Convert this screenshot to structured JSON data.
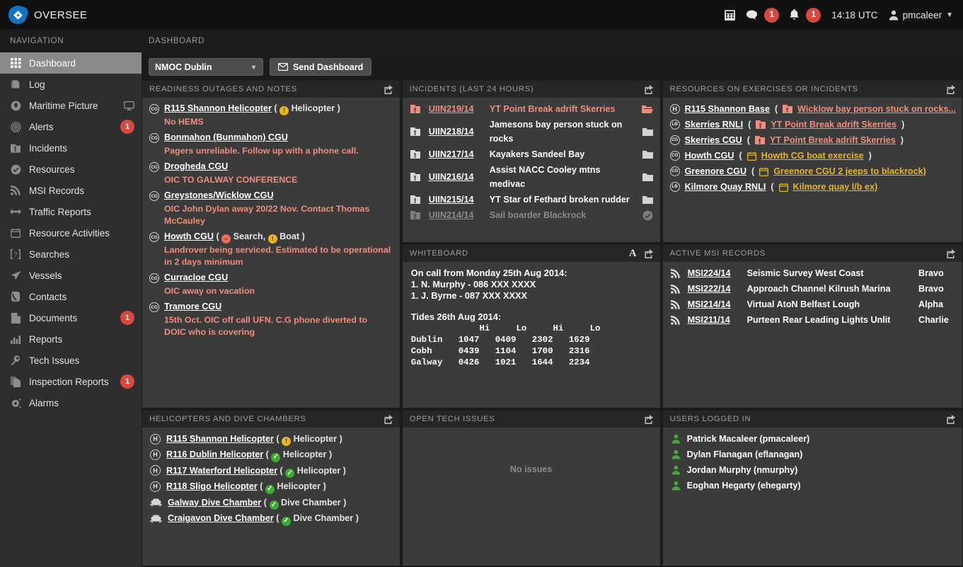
{
  "app": {
    "name": "OVERSEE"
  },
  "topbar": {
    "calculator_icon": "calculator-icon",
    "messages_icon": "chat-icon",
    "messages_count": "1",
    "alerts_icon": "bell-icon",
    "alerts_count": "1",
    "clock": "14:18 UTC",
    "user": "pmcaleer"
  },
  "sidebar": {
    "title": "NAVIGATION",
    "items": [
      {
        "label": "Dashboard",
        "icon": "grid-icon",
        "active": true
      },
      {
        "label": "Log",
        "icon": "book-icon"
      },
      {
        "label": "Maritime Picture",
        "icon": "globe-icon",
        "trailing_icon": "monitor-icon"
      },
      {
        "label": "Alerts",
        "icon": "target-icon",
        "badge": "1"
      },
      {
        "label": "Incidents",
        "icon": "incident-icon"
      },
      {
        "label": "Resources",
        "icon": "check-circle-icon"
      },
      {
        "label": "MSI Records",
        "icon": "rss-icon"
      },
      {
        "label": "Traffic Reports",
        "icon": "arrows-icon"
      },
      {
        "label": "Resource Activities",
        "icon": "calendar-icon"
      },
      {
        "label": "Searches",
        "icon": "search-brackets-icon"
      },
      {
        "label": "Vessels",
        "icon": "vessel-icon"
      },
      {
        "label": "Contacts",
        "icon": "phone-icon"
      },
      {
        "label": "Documents",
        "icon": "document-icon",
        "badge": "1"
      },
      {
        "label": "Reports",
        "icon": "chart-icon"
      },
      {
        "label": "Tech Issues",
        "icon": "wrench-icon"
      },
      {
        "label": "Inspection Reports",
        "icon": "copy-icon",
        "badge": "1"
      },
      {
        "label": "Alarms",
        "icon": "alarm-icon"
      }
    ]
  },
  "main": {
    "header": "DASHBOARD",
    "toolbar": {
      "location_select": "NMOC Dublin",
      "send_dashboard": "Send Dashboard",
      "send_icon": "envelope-icon"
    }
  },
  "panels": {
    "readiness": {
      "title": "READINESS OUTAGES AND NOTES",
      "export_icon": "export-icon",
      "items": [
        {
          "name": "R115 Shannon Helicopter",
          "badge_icon": "cg-icon",
          "status": [
            {
              "type": "warn",
              "label": "Helicopter"
            }
          ],
          "note": "No HEMS"
        },
        {
          "name": "Bonmahon (Bunmahon) CGU",
          "badge_icon": "cg-icon",
          "status": [],
          "note": "Pagers unreliable. Follow up with a phone call."
        },
        {
          "name": "Drogheda CGU",
          "badge_icon": "cg-icon",
          "status": [],
          "note": "OIC TO GALWAY CONFERENCE"
        },
        {
          "name": "Greystones/Wicklow CGU",
          "badge_icon": "cg-icon",
          "status": [],
          "note": "OIC John Dylan away 20/22 Nov. Contact Thomas McCauley"
        },
        {
          "name": "Howth CGU",
          "badge_icon": "cg-icon",
          "status": [
            {
              "type": "stop",
              "label": "Search"
            },
            {
              "type": "warn",
              "label": "Boat"
            }
          ],
          "note": "Landrover being serviced. Estimated to be operational in 2 days minimum"
        },
        {
          "name": "Curracloe CGU",
          "badge_icon": "cg-icon",
          "status": [],
          "note": "OIC away on vacation"
        },
        {
          "name": "Tramore CGU",
          "badge_icon": "cg-icon",
          "status": [],
          "note": "15th Oct. OIC off call UFN. C.G phone diverted to DOIC who is covering"
        }
      ]
    },
    "incidents": {
      "title": "INCIDENTS (LAST 24 HOURS)",
      "export_icon": "export-icon",
      "rows": [
        {
          "id": "UIIN219/14",
          "desc": "YT Point Break adrift Skerries",
          "state": "alert",
          "flag_icon": "incident-icon",
          "end_icon": "folder-open-icon"
        },
        {
          "id": "UIIN218/14",
          "desc": "Jamesons bay person stuck on rocks",
          "state": "normal",
          "flag_icon": "incident-icon",
          "end_icon": "folder-icon"
        },
        {
          "id": "UIIN217/14",
          "desc": "Kayakers Sandeel Bay",
          "state": "normal",
          "flag_icon": "incident-icon",
          "end_icon": "folder-icon"
        },
        {
          "id": "UIIN216/14",
          "desc": "Assist NACC Cooley mtns medivac",
          "state": "normal",
          "flag_icon": "incident-icon",
          "end_icon": "folder-icon"
        },
        {
          "id": "UIIN215/14",
          "desc": "YT Star of Fethard broken rudder",
          "state": "normal",
          "flag_icon": "incident-icon",
          "end_icon": "folder-icon"
        },
        {
          "id": "UIIN214/14",
          "desc": "Sail boarder Blackrock",
          "state": "done",
          "flag_icon": "incident-icon",
          "end_icon": "check-circle-icon"
        }
      ]
    },
    "resources": {
      "title": "RESOURCES ON EXERCISES OR INCIDENTS",
      "export_icon": "export-icon",
      "rows": [
        {
          "badge": "H",
          "name": "R115 Shannon Base",
          "link_icon": "incident-icon",
          "link": "Wicklow bay person stuck on rocks...",
          "link_type": "incident",
          "open_paren": "(",
          "close_paren": ""
        },
        {
          "badge": "LB",
          "name": "Skerries RNLI",
          "link_icon": "incident-icon",
          "link": "YT Point Break adrift Skerries",
          "link_type": "incident",
          "open_paren": "(",
          "close_paren": ")"
        },
        {
          "badge": "CG",
          "name": "Skerries CGU",
          "link_icon": "incident-icon",
          "link": "YT Point Break adrift Skerries",
          "link_type": "incident",
          "open_paren": "(",
          "close_paren": ")"
        },
        {
          "badge": "CG",
          "name": "Howth CGU",
          "link_icon": "calendar-icon",
          "link": "Howth CG boat exercise",
          "link_type": "exercise",
          "open_paren": "(",
          "close_paren": ")"
        },
        {
          "badge": "CG",
          "name": "Greenore CGU",
          "link_icon": "calendar-icon",
          "link": "Greenore CGU 2 jeeps to blackrock)",
          "link_type": "exercise",
          "open_paren": "(",
          "close_paren": ""
        },
        {
          "badge": "LB",
          "name": "Kilmore Quay RNLI",
          "link_icon": "calendar-icon",
          "link": "Kilmore quay l/b ex)",
          "link_type": "exercise",
          "open_paren": "(",
          "close_paren": ""
        }
      ]
    },
    "whiteboard": {
      "title": "WHITEBOARD",
      "font_icon": "font-icon",
      "export_icon": "export-icon",
      "lines": [
        "On call from Monday 25th Aug 2014:",
        "1. N. Murphy - 086 XXX XXXX",
        "1. J. Byrne - 087 XXX XXXX"
      ],
      "tides_title": "Tides 26th Aug 2014:",
      "tides_header": "         Hi     Hi     Hi     Lo",
      "tides_table": "             Hi     Lo     Hi     Lo\nDublin   1047   0409   2302   1629\nCobh     0439   1104   1700   2316\nGalway   0426   1021   1644   2234"
    },
    "msi": {
      "title": "ACTIVE MSI RECORDS",
      "export_icon": "export-icon",
      "rows": [
        {
          "icon": "rss-icon",
          "id": "MSI224/14",
          "desc": "Seismic Survey West Coast",
          "cat": "Bravo"
        },
        {
          "icon": "rss-icon",
          "id": "MSI222/14",
          "desc": "Approach Channel Kilrush Marina",
          "cat": "Bravo"
        },
        {
          "icon": "rss-icon",
          "id": "MSI214/14",
          "desc": "Virtual AtoN Belfast Lough",
          "cat": "Alpha"
        },
        {
          "icon": "rss-icon",
          "id": "MSI211/14",
          "desc": "Purteen Rear Leading Lights Unlit",
          "cat": "Charlie"
        }
      ]
    },
    "helicopters": {
      "title": "HELICOPTERS AND DIVE CHAMBERS",
      "export_icon": "export-icon",
      "rows": [
        {
          "badge": "H",
          "badge_type": "circle",
          "name": "R115 Shannon Helicopter",
          "status": "warn",
          "kind": "Helicopter"
        },
        {
          "badge": "H",
          "badge_type": "circle",
          "name": "R116 Dublin Helicopter",
          "status": "ok",
          "kind": "Helicopter"
        },
        {
          "badge": "H",
          "badge_type": "circle",
          "name": "R117 Waterford Helicopter",
          "status": "ok",
          "kind": "Helicopter"
        },
        {
          "badge": "H",
          "badge_type": "circle",
          "name": "R118 Sligo Helicopter",
          "status": "ok",
          "kind": "Helicopter"
        },
        {
          "badge": "chamber-icon",
          "badge_type": "chamber",
          "name": "Galway Dive Chamber",
          "status": "ok",
          "kind": "Dive Chamber"
        },
        {
          "badge": "chamber-icon",
          "badge_type": "chamber",
          "name": "Craigavon Dive Chamber",
          "status": "ok",
          "kind": "Dive Chamber"
        }
      ]
    },
    "tech": {
      "title": "OPEN TECH ISSUES",
      "export_icon": "export-icon",
      "empty_text": "No issues"
    },
    "users": {
      "title": "USERS LOGGED IN",
      "export_icon": "export-icon",
      "rows": [
        {
          "icon": "user-icon",
          "name": "Patrick Macaleer (pmacaleer)"
        },
        {
          "icon": "user-icon",
          "name": "Dylan Flanagan (eflanagan)"
        },
        {
          "icon": "user-icon",
          "name": "Jordan Murphy (nmurphy)"
        },
        {
          "icon": "user-icon",
          "name": "Eoghan Hegarty (ehegarty)"
        }
      ]
    }
  },
  "colors": {
    "accent_blue": "#1173c4",
    "badge_red": "#d8483f",
    "alert_salmon": "#ee8d7d",
    "amber": "#e8b51e",
    "green": "#3cab2f",
    "panel_bg": "#3b3b3b",
    "panel_head": "#262626"
  }
}
